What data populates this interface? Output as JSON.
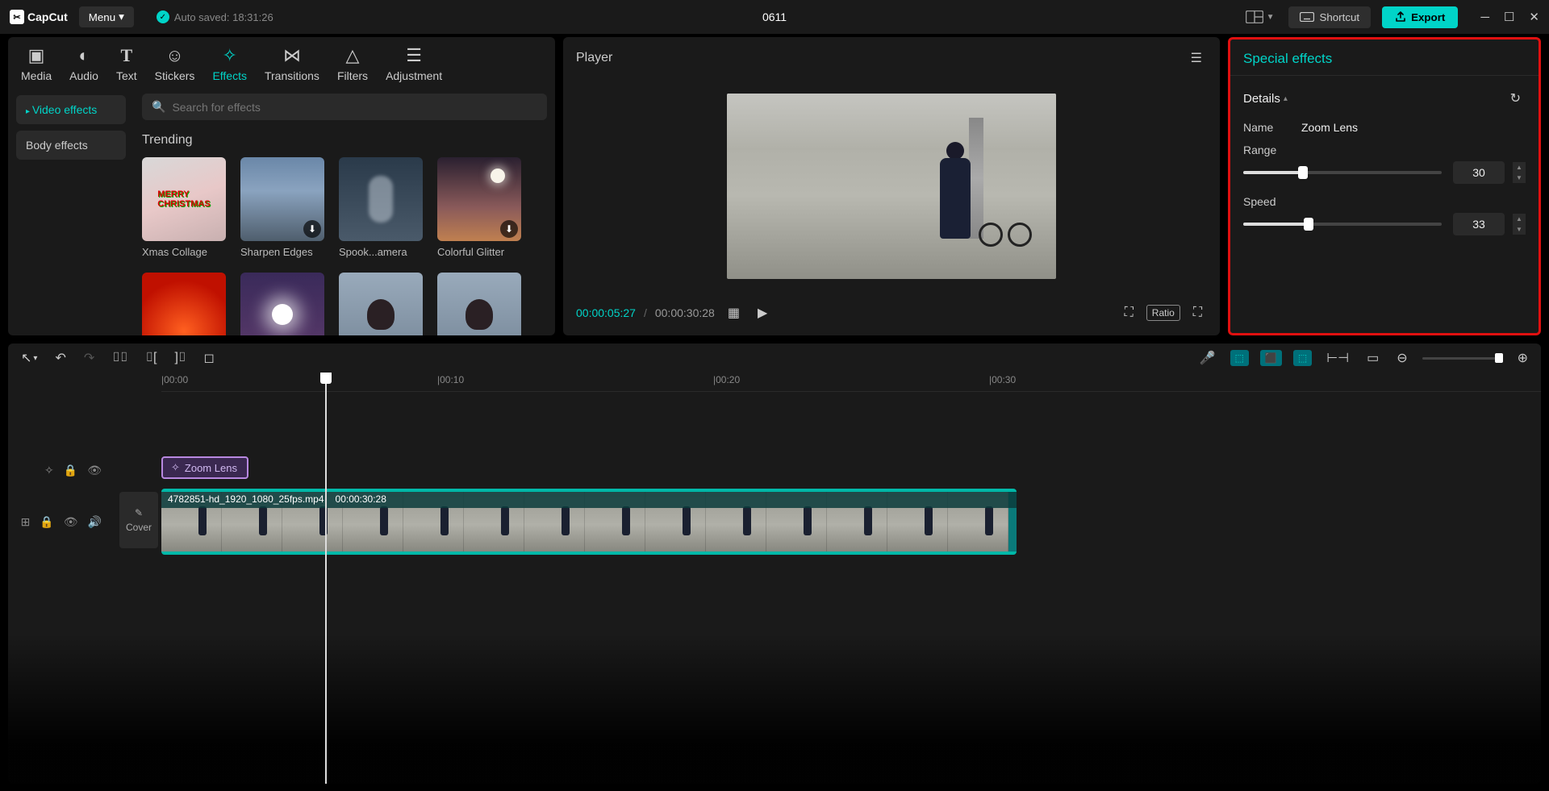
{
  "app": {
    "name": "CapCut"
  },
  "topbar": {
    "menu_label": "Menu",
    "autosave_label": "Auto saved: 18:31:26",
    "project_title": "0611",
    "shortcut_label": "Shortcut",
    "export_label": "Export"
  },
  "media_tabs": {
    "media": "Media",
    "audio": "Audio",
    "text": "Text",
    "stickers": "Stickers",
    "effects": "Effects",
    "transitions": "Transitions",
    "filters": "Filters",
    "adjustment": "Adjustment",
    "active": "effects"
  },
  "effects_sidebar": {
    "video_effects": "Video effects",
    "body_effects": "Body effects"
  },
  "search": {
    "placeholder": "Search for effects"
  },
  "effects_section": {
    "label": "Trending",
    "items": [
      {
        "name": "Xmas Collage"
      },
      {
        "name": "Sharpen Edges"
      },
      {
        "name": "Spook...amera"
      },
      {
        "name": "Colorful Glitter"
      }
    ]
  },
  "player": {
    "title": "Player",
    "current": "00:00:05:27",
    "total": "00:00:30:28",
    "ratio_label": "Ratio"
  },
  "props": {
    "tab": "Special effects",
    "section": "Details",
    "name_label": "Name",
    "name_value": "Zoom Lens",
    "range_label": "Range",
    "range_value": "30",
    "speed_label": "Speed",
    "speed_value": "33"
  },
  "ruler": {
    "t0": "|00:00",
    "t10": "|00:10",
    "t20": "|00:20",
    "t30": "|00:30"
  },
  "timeline": {
    "effect_clip_label": "Zoom Lens",
    "cover_label": "Cover",
    "media_clip_name": "4782851-hd_1920_1080_25fps.mp4",
    "media_clip_duration": "00:00:30:28"
  }
}
